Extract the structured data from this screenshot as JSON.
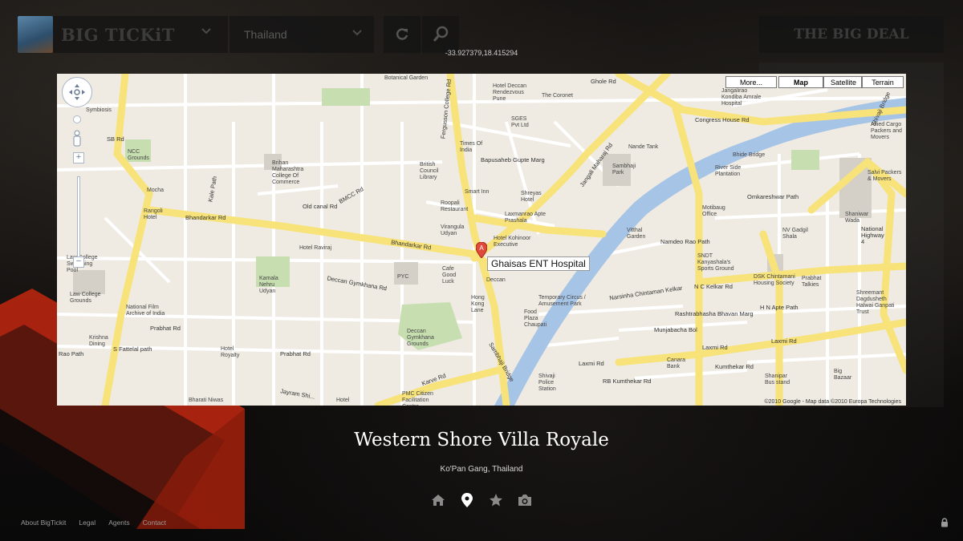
{
  "header": {
    "brand": "BIG TICKiT",
    "country": "Thailand",
    "deal": "THE BIG DEAL",
    "coordinates": "-33.927379,18.415294"
  },
  "map": {
    "map_type_buttons": [
      "More...",
      "Map",
      "Satellite",
      "Terrain"
    ],
    "active_map_type": "Map",
    "marker_letter": "A",
    "marker_label": "Ghaisas ENT Hospital",
    "credit": "©2010 Google - Map data ©2010 Europa Technologies",
    "labels": {
      "botanical_garden": "Botanical Garden",
      "hotel_deccan": "Hotel Deccan Rendezvous Pune",
      "coronet": "The Coronet",
      "sges": "SGES Pvt Ltd",
      "ghole_rd": "Ghole Rd",
      "jangalirao": "Jangalirao Kondiba Amrale Hospital",
      "congress": "Congress House Rd",
      "allied": "Allied Cargo Packers and Movers",
      "symbiosis": "Symbiosis",
      "ncc": "NCC Grounds",
      "sb_rd": "SB Rd",
      "times": "Times Of India",
      "bapusaheb": "Bapusaheb Gupte Marg",
      "nande": "Nande Tank",
      "sambhaji_park": "Sambhaji Park",
      "bhide": "Bhide Bridge",
      "river_side": "River Side Plantation",
      "salvi": "Salvi Packers & Movers",
      "brihan": "Brihan Maharashtra College Of Commerce",
      "british_council": "British Council Library",
      "smart_inn": "Smart Inn",
      "shreyas": "Shreyas Hotel",
      "omkareshwar": "Omkareshwar Path",
      "motibaug": "Motibaug Office",
      "shaniwar": "Shaniwar Wada",
      "mocha": "Mocha",
      "kale_path": "Kale Path",
      "bmcc": "BMCC Rd",
      "old_canal": "Old canal Rd",
      "roopali": "Roopali Restaurant",
      "laxmanrao": "Laxmanrao Apte Prashala",
      "rangoli": "Rangoli Hotel",
      "bhandarkar": "Bhandarkar Rd",
      "virangula": "Virangula Udyan",
      "kohinoor": "Hotel Kohinoor Executive",
      "vitthal": "Vitthal Garden",
      "namdeo": "Namdeo Rao Path",
      "nv_gadgil": "NV Gadgil Shala",
      "national_hwy": "National Highway 4",
      "law_college_pool": "Law College Swimming Pool",
      "hotel_raviraj": "Hotel Raviraj",
      "pyc": "PYC",
      "cafe_good_luck": "Cafe Good Luck",
      "deccan": "Deccan",
      "sndt": "SNDT Kanyashala's Sports Ground",
      "nc_kelkar": "N C Kelkar Rd",
      "dsk": "DSK Chintamani Housing Society",
      "prabhat_talkies": "Prabhat Talkies",
      "shreemant": "Shreemant Dagdusheth Halwai Ganpati Trust",
      "kamala": "Kamala Nehru Udyan",
      "law_college": "Law College Grounds",
      "national_film": "National Film Archive of India",
      "deccan_gym_rd": "Deccan Gymkhana Rd",
      "hong_kong": "Hong Kong Lane",
      "temporary_circus": "Temporary Circus / Amusement Park",
      "narsinha": "Narsinha Chintaman Kelkar",
      "rashtrabhasha": "Rashtrabhasha Bhavan Marg",
      "hn_apte": "H N Apte Path",
      "prabhat_rd": "Prabhat Rd",
      "krishna": "Krishna Dining",
      "fattelal": "S Fattelal path",
      "deccan_gym_grounds": "Deccan Gymkhana Grounds",
      "food_plaza": "Food Plaza Chaupati",
      "munjabacha": "Munjabacha Bol",
      "laxmi_rd": "Laxmi Rd",
      "rao_path": "Rao Path",
      "hotel_royalty": "Hotel Royalty",
      "karve": "Karve Rd",
      "sambhaji_bridge": "Sambhaji Bridge",
      "shivaji_police": "Shivaji Police Station",
      "rb_kumthekar": "RB Kumthekar Rd",
      "canara": "Canara Bank",
      "kumthekar": "Kumthekar Rd",
      "shanipar": "Shanipar Bus stand",
      "big_bazaar": "Big Bazaar",
      "bharati": "Bharati Niwas",
      "jayram": "Jayram Shi...",
      "pmc": "PMC Citizen Facilitation Centre",
      "hotel": "Hotel",
      "fergusson": "Fergusson College Rd",
      "jangali_maharaj": "Jangali Maharaj Rd",
      "shivaji_bridge": "Shivaji Bridge"
    }
  },
  "listing": {
    "title": "Western Shore Villa Royale",
    "location": "Ko'Pan Gang, Thailand"
  },
  "tabs": [
    "home-icon",
    "map-pin-icon",
    "star-icon",
    "camera-icon"
  ],
  "footer": {
    "links": [
      "About BigTickit",
      "Legal",
      "Agents",
      "Contact"
    ]
  },
  "colors": {
    "accent_red": "#d2321a",
    "road_yellow": "#f7e37a",
    "river_blue": "#a6c4e6",
    "park_green": "#c7dfb0"
  }
}
